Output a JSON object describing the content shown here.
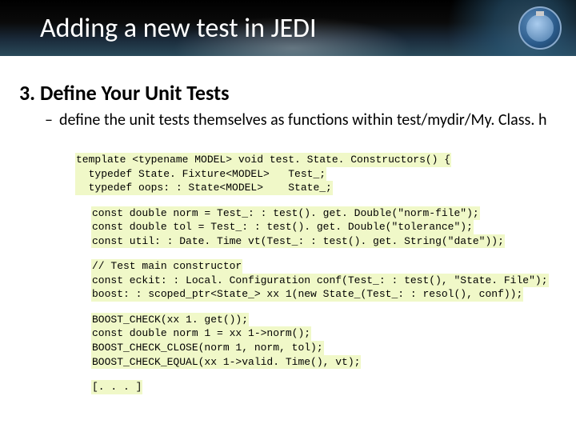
{
  "header": {
    "title": "Adding a new test in JEDI"
  },
  "section": {
    "number": "3.",
    "heading": "Define Your Unit Tests",
    "sub": "define the unit tests themselves as functions within test/mydir/My. Class. h"
  },
  "code": {
    "b1": {
      "l1": "template <typename MODEL> void test. State. Constructors() {",
      "l2": "  typedef State. Fixture<MODEL>   Test_;",
      "l3": "  typedef oops: : State<MODEL>    State_;"
    },
    "b2": {
      "l1": "const double norm = Test_: : test(). get. Double(\"norm-file\");",
      "l2": "const double tol = Test_: : test(). get. Double(\"tolerance\");",
      "l3": "const util: : Date. Time vt(Test_: : test(). get. String(\"date\"));"
    },
    "b3": {
      "l1": "// Test main constructor",
      "l2": "const eckit: : Local. Configuration conf(Test_: : test(), \"State. File\");",
      "l3": "boost: : scoped_ptr<State_> xx 1(new State_(Test_: : resol(), conf));"
    },
    "b4": {
      "l1": "BOOST_CHECK(xx 1. get());",
      "l2": "const double norm 1 = xx 1->norm();",
      "l3": "BOOST_CHECK_CLOSE(norm 1, norm, tol);",
      "l4": "BOOST_CHECK_EQUAL(xx 1->valid. Time(), vt);"
    },
    "b5": {
      "l1": "[. . . ]"
    }
  }
}
